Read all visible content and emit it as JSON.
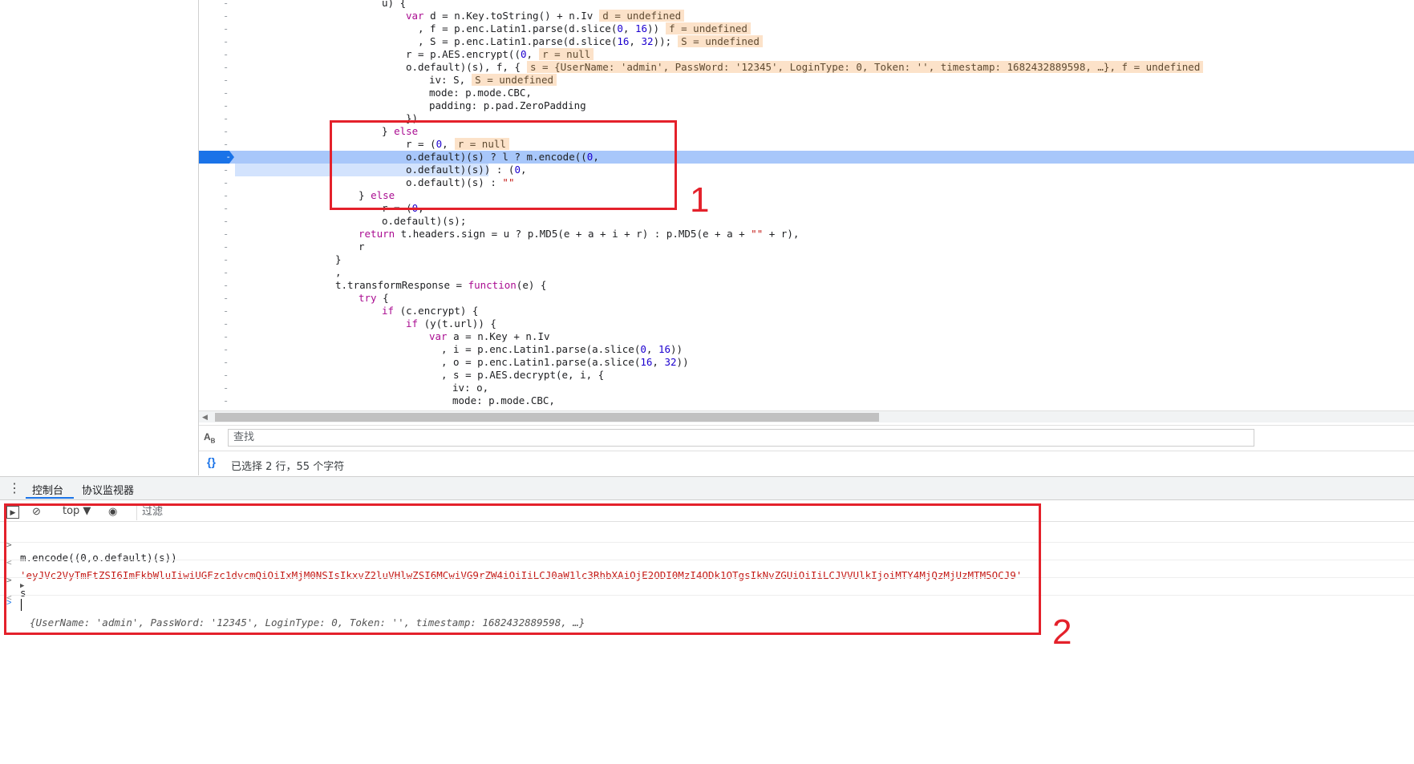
{
  "source_editor": {
    "gutter_marker": "-",
    "lines": [
      {
        "code": "u) {"
      },
      {
        "code": "var d = n.Key.toString() + n.Iv",
        "annotation": "d = undefined"
      },
      {
        "code": ", f = p.enc.Latin1.parse(d.slice(0, 16))",
        "annotation": "f = undefined"
      },
      {
        "code": ", S = p.enc.Latin1.parse(d.slice(16, 32));",
        "annotation": "S = undefined"
      },
      {
        "code": "r = p.AES.encrypt((0,",
        "annotation": "r = null"
      },
      {
        "code": "o.default)(s), f, {",
        "annotation": "s = {UserName: 'admin', PassWord: '12345', LoginType: 0, Token: '', timestamp: 1682432889598, …}, f = undefined"
      },
      {
        "code": "iv: S,",
        "annotation": "S = undefined"
      },
      {
        "code": "mode: p.mode.CBC,"
      },
      {
        "code": "padding: p.pad.ZeroPadding"
      },
      {
        "code": "})"
      },
      {
        "code": "} else"
      },
      {
        "code": "r = (0,",
        "annotation": "r = null"
      },
      {
        "code": "o.default)(s) ? l ? m.encode((0,"
      },
      {
        "code": "o.default)(s)) : (0,"
      },
      {
        "code": "o.default)(s) : \"\""
      },
      {
        "code": "} else"
      },
      {
        "code": "r = (0,"
      },
      {
        "code": "o.default)(s);"
      },
      {
        "code": "return t.headers.sign = u ? p.MD5(e + a + i + r) : p.MD5(e + a + \"\" + r),"
      },
      {
        "code": "r"
      },
      {
        "code": "}"
      },
      {
        "code": ","
      },
      {
        "code": "t.transformResponse = function(e) {"
      },
      {
        "code": "try {"
      },
      {
        "code": "if (c.encrypt) {"
      },
      {
        "code": "if (y(t.url)) {"
      },
      {
        "code": "var a = n.Key + n.Iv"
      },
      {
        "code": ", i = p.enc.Latin1.parse(a.slice(0, 16))"
      },
      {
        "code": ", o = p.enc.Latin1.parse(a.slice(16, 32))"
      },
      {
        "code": ", s = p.AES.decrypt(e, i, {"
      },
      {
        "code": "iv: o,"
      },
      {
        "code": "mode: p.mode.CBC,"
      }
    ]
  },
  "find_bar": {
    "placeholder": "查找"
  },
  "status_bar": {
    "text": "已选择 2 行，55 个字符"
  },
  "drawer": {
    "tabs": [
      "控制台",
      "协议监视器"
    ]
  },
  "console_toolbar": {
    "context": "top ▼",
    "filter_placeholder": "过滤"
  },
  "console": {
    "entries": [
      {
        "type": "input",
        "text": "m.encode((0,o.default)(s))"
      },
      {
        "type": "output",
        "text": "'eyJVc2VyTmFtZSI6ImFkbWluIiwiUGFzc1dvcmQiOiIxMjM0NSIsIkxvZ2luVHlwZSI6MCwiVG9rZW4iOiIiLCJ0aW1lc3RhbXAiOjE2ODI0MzI4ODk1OTgsIkNvZGUiOiIiLCJVVUlkIjoiMTY4MjQzMjUzMTM5OCJ9'"
      },
      {
        "type": "input",
        "text": "s"
      },
      {
        "type": "output",
        "text": "{UserName: 'admin', PassWord: '12345', LoginType: 0, Token: '', timestamp: 1682432889598, …}"
      }
    ]
  },
  "annotations": {
    "label_1": "1",
    "label_2": "2"
  },
  "colors": {
    "highlight_box": "#e4212b",
    "execution_line": "#a8c7fa",
    "selected_line": "#d3e3fd",
    "scope_value": "#fce2c9"
  }
}
